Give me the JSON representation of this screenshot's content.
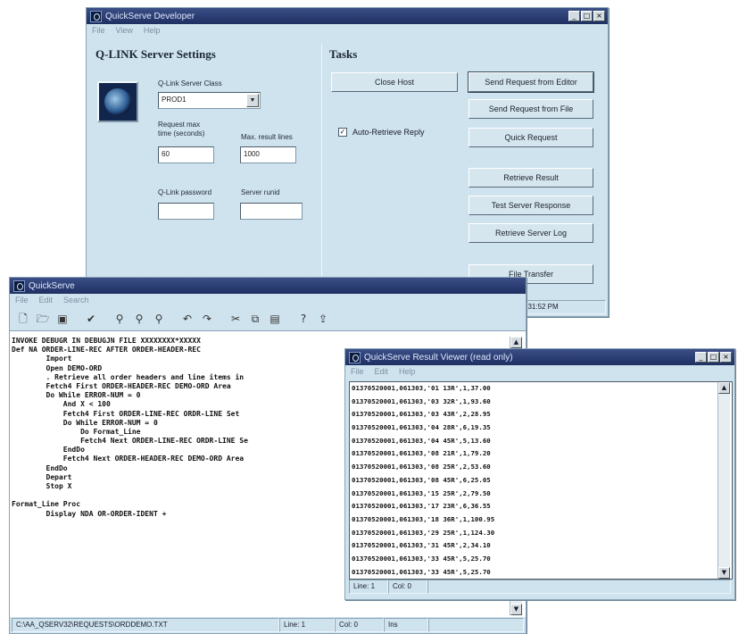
{
  "developer": {
    "title": "QuickServe Developer",
    "menu": [
      "File",
      "View",
      "Help"
    ],
    "settings_title": "Q-LINK Server Settings",
    "tasks_title": "Tasks",
    "server_class_label": "Q-Link Server Class",
    "server_class_value": "PROD1",
    "request_max_label_1": "Request max",
    "request_max_label_2": "time (seconds)",
    "request_max_value": "60",
    "max_result_label": "Max. result lines",
    "max_result_value": "1000",
    "password_label": "Q-Link password",
    "server_uid_label": "Server runid",
    "password_value": "",
    "server_uid_value": "",
    "auto_retrieve_label": "Auto-Retrieve Reply",
    "auto_retrieve_checked": true,
    "buttons": {
      "close_host": "Close Host",
      "send_editor": "Send Request from Editor",
      "send_file": "Send Request from File",
      "quick_request": "Quick Request",
      "retrieve_result": "Retrieve Result",
      "test_server": "Test Server Response",
      "retrieve_log": "Retrieve Server Log",
      "file_transfer": "File Transfer"
    },
    "status_datetime": "11/12/99 1:31:52 PM"
  },
  "editor": {
    "title": "QuickServe",
    "menu": [
      "File",
      "Edit",
      "Search"
    ],
    "toolbar_icons": [
      "new-file-icon",
      "open-folder-icon",
      "save-icon",
      "check-icon",
      "find-icon",
      "find-next-icon",
      "replace-icon",
      "undo-icon",
      "redo-icon",
      "cut-icon",
      "copy-icon",
      "paste-icon",
      "help-icon",
      "send-icon"
    ],
    "code": [
      "INVOKE DEBUGR IN DEBUGJN FILE XXXXXXXX*XXXXX",
      "Def NA ORDER-LINE-REC AFTER ORDER-HEADER-REC",
      "        Import",
      "        Open DEMO-ORD",
      "        . Retrieve all order headers and line items in",
      "        Fetch4 First ORDER-HEADER-REC DEMO-ORD Area",
      "        Do While ERROR-NUM = 0",
      "            And X < 100",
      "            Fetch4 First ORDER-LINE-REC ORDR-LINE Set",
      "            Do While ERROR-NUM = 0",
      "                Do Format_Line",
      "                Fetch4 Next ORDER-LINE-REC ORDR-LINE Se",
      "            EndDo",
      "            Fetch4 Next ORDER-HEADER-REC DEMO-ORD Area",
      "        EndDo",
      "        Depart",
      "        Stop X",
      "",
      "Format_Line Proc",
      "        Display NDA OR-ORDER-IDENT +"
    ],
    "status_path": "C:\\AA_QSERV32\\REQUESTS\\ORDDEMO.TXT",
    "status_line": "Line: 1",
    "status_col": "Col: 0",
    "status_ins": "Ins"
  },
  "viewer": {
    "title": "QuickServe Result Viewer (read only)",
    "menu": [
      "File",
      "Edit",
      "Help"
    ],
    "lines": [
      "01370520001,061303,'01 13R',1,37.00",
      "01370520001,061303,'03 32R',1,93.60",
      "01370520001,061303,'03 43R',2,28.95",
      "01370520001,061303,'04 28R',6,19.35",
      "01370520001,061303,'04 45R',5,13.60",
      "01370520001,061303,'08 21R',1,79.20",
      "01370520001,061303,'08 25R',2,53.60",
      "01370520001,061303,'08 45R',6,25.05",
      "01370520001,061303,'15 25R',2,79.50",
      "01370520001,061303,'17 23R',6,36.55",
      "01370520001,061303,'18 36R',1,100.95",
      "01370520001,061303,'29 25R',1,124.30",
      "01370520001,061303,'31 45R',2,34.10",
      "01370520001,061303,'33 45R',5,25.70",
      "01370520001,061303,'33 45R',5,25.70"
    ],
    "status_line": "Line: 1",
    "status_col": "Col: 0"
  }
}
